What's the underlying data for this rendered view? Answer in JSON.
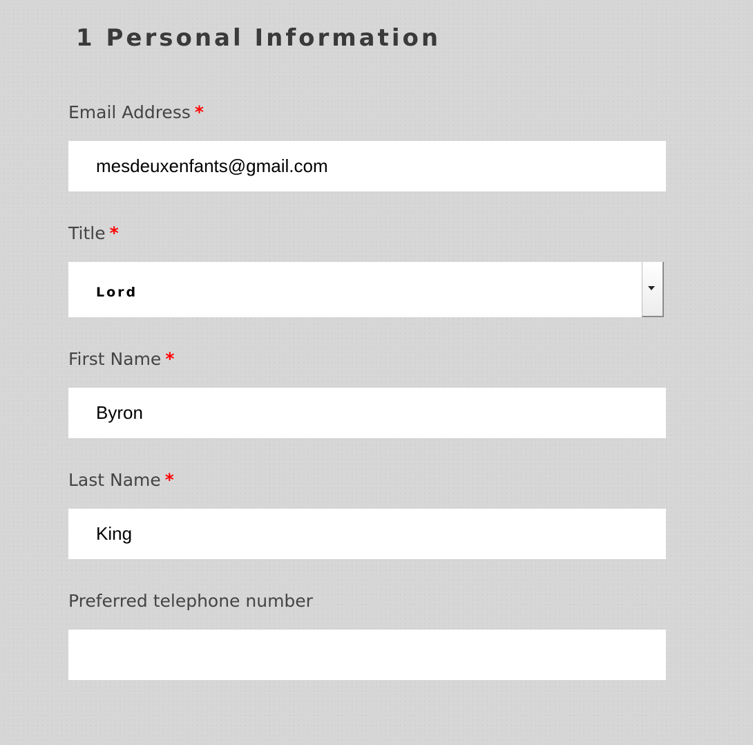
{
  "section": {
    "title": "1 Personal Information"
  },
  "form": {
    "required_marker": "*",
    "email": {
      "label": "Email Address",
      "value": "mesdeuxenfants@gmail.com"
    },
    "title_field": {
      "label": "Title",
      "selected": "Lord"
    },
    "first_name": {
      "label": "First Name",
      "value": "Byron"
    },
    "last_name": {
      "label": "Last Name",
      "value": "King"
    },
    "telephone": {
      "label": "Preferred telephone number",
      "value": ""
    }
  },
  "icons": {
    "select_arrow": "chevron-down-icon"
  },
  "colors": {
    "background": "#d6d6d6",
    "required": "#ff0000",
    "label_text": "#444444",
    "heading_text": "#3a3a3a",
    "input_bg": "#ffffff"
  }
}
